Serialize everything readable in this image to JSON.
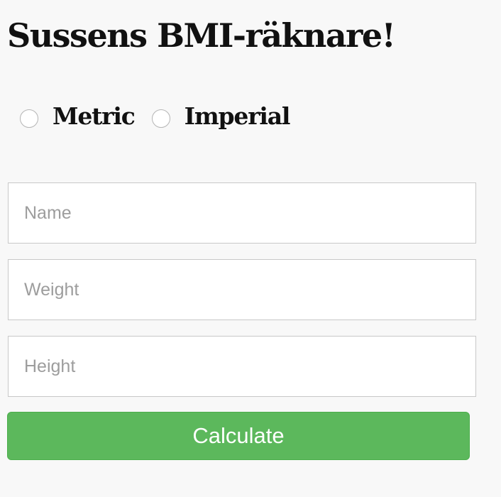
{
  "header": {
    "title": "Sussens BMI-räknare!"
  },
  "unit_options": [
    {
      "label": "Metric",
      "selected": false
    },
    {
      "label": "Imperial",
      "selected": false
    }
  ],
  "form": {
    "name_placeholder": "Name",
    "weight_placeholder": "Weight",
    "height_placeholder": "Height",
    "name_value": "",
    "weight_value": "",
    "height_value": "",
    "calculate_label": "Calculate"
  },
  "colors": {
    "background": "#f8f8f8",
    "button": "#5cb85c",
    "button_text": "#ffffff",
    "title_text": "#111111",
    "placeholder": "#9d9d9d"
  }
}
